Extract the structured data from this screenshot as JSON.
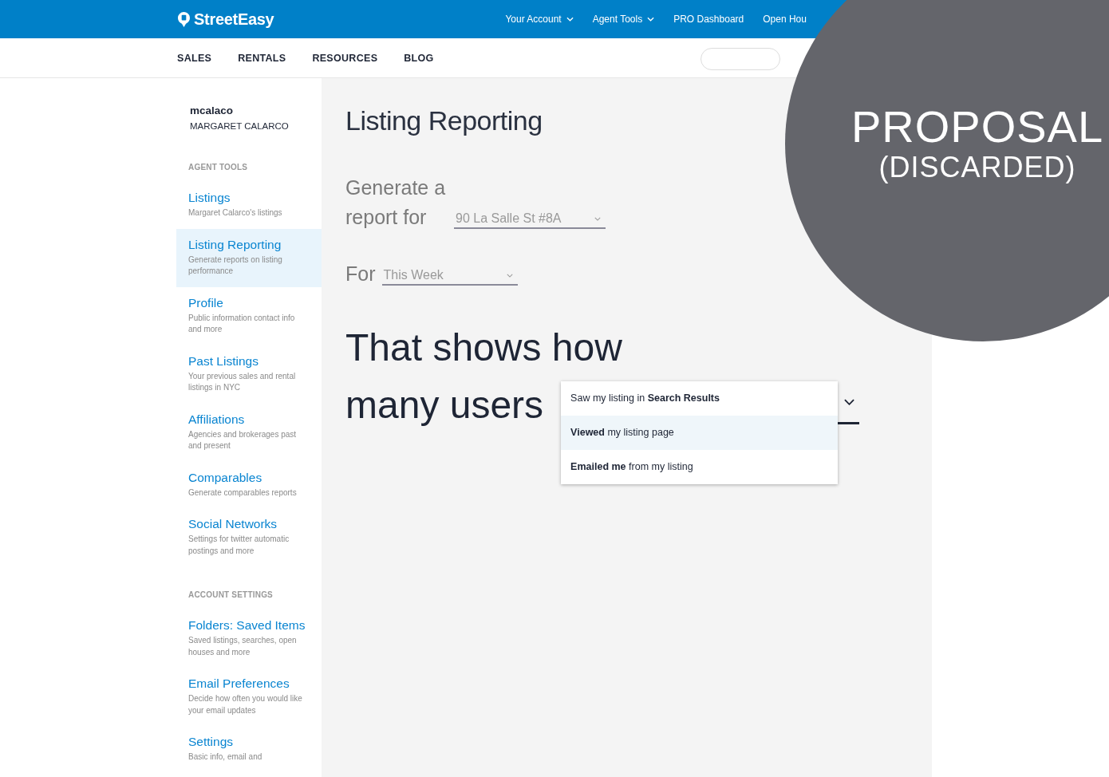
{
  "top_nav": {
    "logo": "StreetEasy",
    "links": [
      {
        "label": "Your Account",
        "kind": "dropdown"
      },
      {
        "label": "Agent Tools",
        "kind": "dropdown"
      },
      {
        "label": "PRO Dashboard",
        "kind": "link"
      },
      {
        "label": "Open Hou",
        "kind": "link"
      }
    ]
  },
  "sub_nav": {
    "links": [
      "SALES",
      "RENTALS",
      "RESOURCES",
      "BLOG"
    ]
  },
  "user": {
    "username": "mcalaco",
    "full_name": "MARGARET CALARCO"
  },
  "sidebar": {
    "sections": [
      {
        "heading": "AGENT TOOLS",
        "items": [
          {
            "title": "Listings",
            "description": "Margaret Calarco's listings",
            "selected": false
          },
          {
            "title": "Listing Reporting",
            "description": "Generate  reports on listing performance",
            "selected": true
          },
          {
            "title": "Profile",
            "description": "Public information contact info and more",
            "selected": false
          },
          {
            "title": "Past Listings",
            "description": "Your previous sales and rental listings in NYC",
            "selected": false
          },
          {
            "title": "Affiliations",
            "description": "Agencies and brokerages past and present",
            "selected": false
          },
          {
            "title": "Comparables",
            "description": "Generate comparables reports",
            "selected": false
          },
          {
            "title": "Social Networks",
            "description": "Settings for twitter automatic postings and more",
            "selected": false
          }
        ]
      },
      {
        "heading": "ACCOUNT SETTINGS",
        "items": [
          {
            "title": "Folders: Saved Items",
            "description": "Saved listings, searches, open houses and more",
            "selected": false
          },
          {
            "title": "Email Preferences",
            "description": "Decide how often you would like your email updates",
            "selected": false
          },
          {
            "title": "Settings",
            "description": "Basic info, email and",
            "selected": false
          }
        ]
      }
    ]
  },
  "main": {
    "title": "Listing Reporting",
    "report_label": "Generate a report for",
    "listing_value": "90 La Salle St #8A",
    "period_label": "For",
    "period_value": "This Week",
    "sentence_lines": [
      "That shows how",
      "many users"
    ],
    "metric_menu": {
      "options": [
        {
          "label": "Saw my listing in **Search Results**",
          "selected": false
        },
        {
          "label": "**Viewed** my listing page",
          "selected": true
        },
        {
          "label": "**Emailed me** from my listing",
          "selected": false
        }
      ]
    }
  },
  "overlay": {
    "title": "PROPOSAL",
    "subtitle": "(DISCARDED)"
  }
}
